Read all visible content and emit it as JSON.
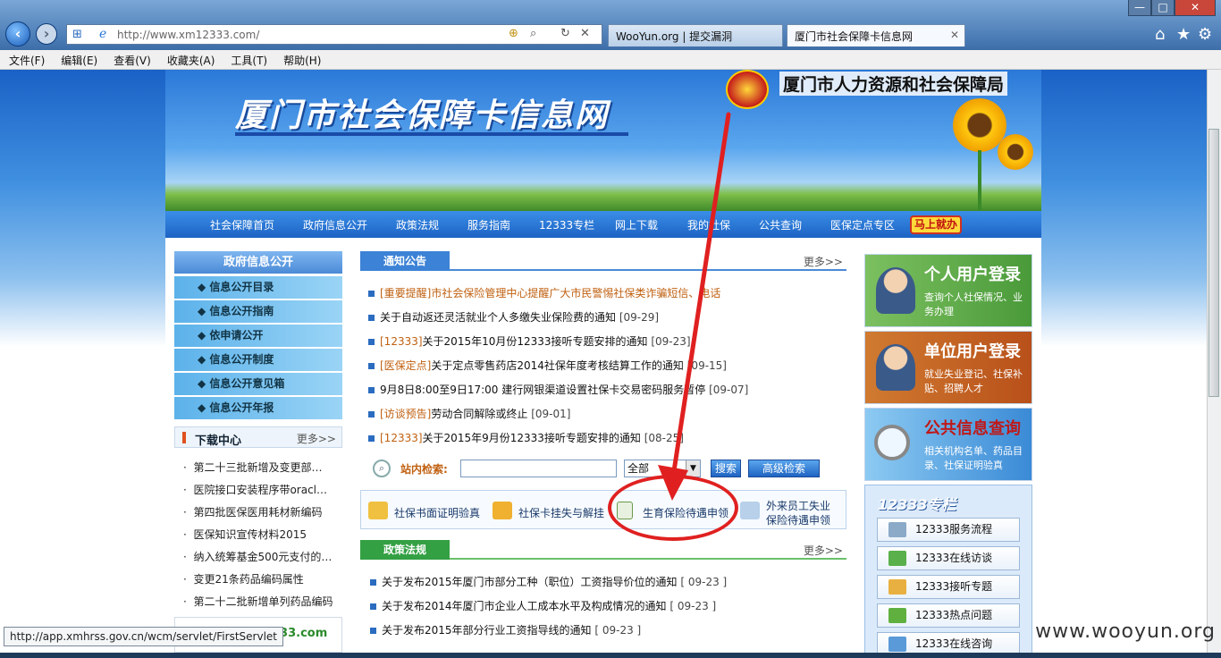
{
  "browser": {
    "url": "http://www.xm12333.com/",
    "tabs": [
      "WooYun.org | 提交漏洞",
      "厦门市社会保障卡信息网"
    ],
    "menu": [
      "文件(F)",
      "编辑(E)",
      "查看(V)",
      "收藏夹(A)",
      "工具(T)",
      "帮助(H)"
    ],
    "window_controls": [
      "—",
      "□",
      "✕"
    ],
    "status_url": "http://app.xmhrss.gov.cn/wcm/servlet/FirstServlet"
  },
  "banner": {
    "title": "厦门市社会保障卡信息网",
    "bureau": "厦门市人力资源和社会保障局"
  },
  "nav": {
    "items": [
      "社会保障首页",
      "政府信息公开",
      "政策法规",
      "服务指南",
      "12333专栏",
      "网上下载",
      "我的社保",
      "公共查询",
      "医保定点专区"
    ],
    "special": "马上就办"
  },
  "left": {
    "head": "政府信息公开",
    "items": [
      "信息公开目录",
      "信息公开指南",
      "依申请公开",
      "信息公开制度",
      "信息公开意见箱",
      "信息公开年报"
    ],
    "download_head": "下载中心",
    "download_more": "更多>>",
    "downloads": [
      "第二十三批新增及变更部…",
      "医院接口安装程序带oracl…",
      "第四批医保医用耗材新编码",
      "医保知识宣传材料2015",
      "纳入统筹基金500元支付的…",
      "变更21条药品编码属性",
      "第二十二批新增单列药品编码"
    ],
    "logo_text": "333.com"
  },
  "notice": {
    "head": "通知公告",
    "more": "更多>>",
    "items": [
      {
        "tag": "[重要提醒]",
        "text": "市社会保险管理中心提醒广大市民警惕社保类诈骗短信、电话",
        "date": ""
      },
      {
        "tag": "",
        "text": "关于自动返还灵活就业个人多缴失业保险费的通知",
        "date": "[09-29]"
      },
      {
        "tag": "[12333]",
        "text": "关于2015年10月份12333接听专题安排的通知",
        "date": "[09-23]"
      },
      {
        "tag": "[医保定点]",
        "text": "关于定点零售药店2014社保年度考核结算工作的通知",
        "date": "[09-15]"
      },
      {
        "tag": "",
        "text": "9月8日8:00至9日17:00 建行网银渠道设置社保卡交易密码服务暂停",
        "date": "[09-07]"
      },
      {
        "tag": "[访谈预告]",
        "text": "劳动合同解除或终止",
        "date": "[09-01]"
      },
      {
        "tag": "[12333]",
        "text": "关于2015年9月份12333接听专题安排的通知",
        "date": "[08-25]"
      }
    ]
  },
  "search": {
    "label": "站内检索:",
    "value": "",
    "scope": "全部",
    "search_btn": "搜索",
    "advanced_btn": "高级检索"
  },
  "services": [
    "社保书面证明验真",
    "社保卡挂失与解挂",
    "生育保险待遇申领",
    "外来员工失业",
    "保险待遇申领"
  ],
  "policy": {
    "head": "政策法规",
    "more": "更多>>",
    "items": [
      {
        "text": "关于发布2015年厦门市部分工种（职位）工资指导价位的通知",
        "date": "[ 09-23 ]"
      },
      {
        "text": "关于发布2014年厦门市企业人工成本水平及构成情况的通知",
        "date": "[ 09-23 ]"
      },
      {
        "text": "关于发布2015年部分行业工资指导线的通知",
        "date": "[ 09-23 ]"
      }
    ]
  },
  "right": {
    "personal": {
      "title": "个人用户登录",
      "sub": "查询个人社保情况、业务办理"
    },
    "unit": {
      "title": "单位用户登录",
      "sub": "就业失业登记、社保补贴、招聘人才"
    },
    "public": {
      "title": "公共信息查询",
      "sub": "相关机构名单、药品目录、社保证明验真"
    },
    "column_head": "12333专栏",
    "column_items": [
      "12333服务流程",
      "12333在线访谈",
      "12333接听专题",
      "12333热点问题",
      "12333在线咨询"
    ]
  },
  "watermark": "www.wooyun.org",
  "colors": {
    "nav_blue": "#1d63c4",
    "annotation_red": "#e02020",
    "policy_green": "#34a044"
  }
}
